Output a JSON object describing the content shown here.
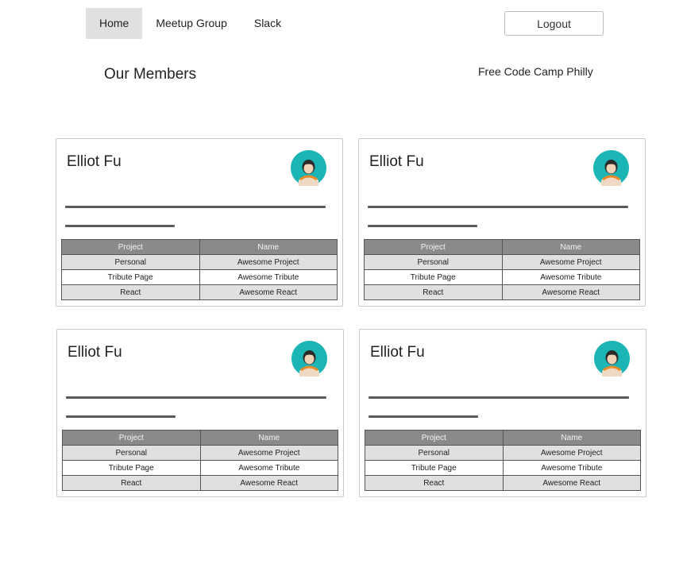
{
  "nav": {
    "items": [
      {
        "label": "Home",
        "active": true
      },
      {
        "label": "Meetup Group",
        "active": false
      },
      {
        "label": "Slack",
        "active": false
      }
    ],
    "logout_label": "Logout"
  },
  "header": {
    "title": "Our Members",
    "org": "Free Code Camp Philly"
  },
  "table_headers": [
    "Project",
    "Name"
  ],
  "members": [
    {
      "name": "Elliot Fu",
      "projects": [
        [
          "Personal",
          "Awesome Project"
        ],
        [
          "Tribute Page",
          "Awesome Tribute"
        ],
        [
          "React",
          "Awesome React"
        ]
      ]
    },
    {
      "name": "Elliot Fu",
      "projects": [
        [
          "Personal",
          "Awesome Project"
        ],
        [
          "Tribute Page",
          "Awesome Tribute"
        ],
        [
          "React",
          "Awesome React"
        ]
      ]
    },
    {
      "name": "Elliot Fu",
      "projects": [
        [
          "Personal",
          "Awesome Project"
        ],
        [
          "Tribute Page",
          "Awesome Tribute"
        ],
        [
          "React",
          "Awesome React"
        ]
      ]
    },
    {
      "name": "Elliot Fu",
      "projects": [
        [
          "Personal",
          "Awesome Project"
        ],
        [
          "Tribute Page",
          "Awesome Tribute"
        ],
        [
          "React",
          "Awesome React"
        ]
      ]
    }
  ],
  "colors": {
    "avatar_bg": "#1cb5b5",
    "active_nav_bg": "#e0e0e0",
    "table_header_bg": "#8a8a8a",
    "row_alt_bg": "#e0e0e0"
  },
  "icons": {
    "avatar": "user-avatar-icon"
  }
}
